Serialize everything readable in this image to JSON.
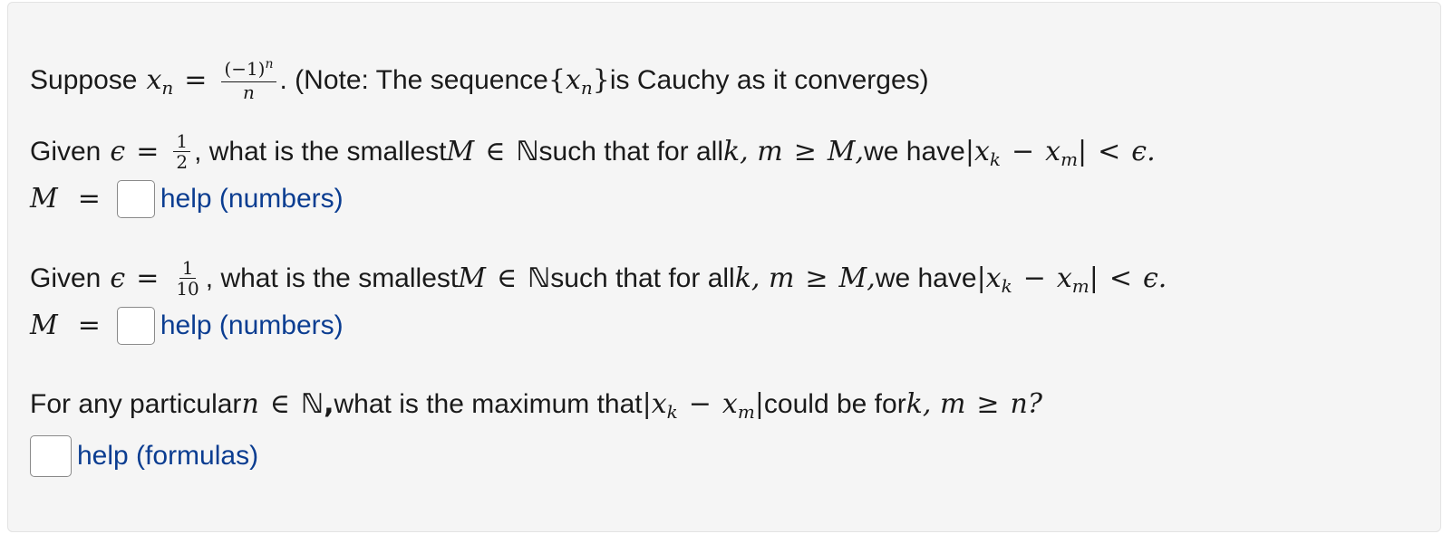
{
  "problem": {
    "intro": {
      "prefix": "Suppose",
      "var": "x",
      "var_sub": "n",
      "eq": "=",
      "frac_num": "(−1)",
      "frac_num_sup": "n",
      "frac_den": "n",
      "suffix_a": ". (Note: The sequence ",
      "seq_open": "{",
      "seq_var": "x",
      "seq_sub": "n",
      "seq_close": "}",
      "suffix_b": " is Cauchy as it converges)"
    },
    "parts": [
      {
        "given": "Given",
        "eps": "ϵ",
        "eq": "=",
        "frac_num": "1",
        "frac_den": "2",
        "text1": ", what is the smallest ",
        "M": "M",
        "in": "∈",
        "N": "ℕ",
        "text2": " such that for all ",
        "km": "k, m",
        "geq": "≥",
        "M2": "M,",
        "text3": " we have ",
        "abs": "|x",
        "sub_k": "k",
        "minus": "−",
        "xm": "x",
        "sub_m": "m",
        "abs_close": "|",
        "lt": "<",
        "eps_end": "ϵ.",
        "answer_label": "M",
        "answer_eq": "=",
        "answer_value": "",
        "help": "help (numbers)"
      },
      {
        "given": "Given",
        "eps": "ϵ",
        "eq": "=",
        "frac_num": "1",
        "frac_den": "10",
        "text1": ", what is the smallest ",
        "M": "M",
        "in": "∈",
        "N": "ℕ",
        "text2": " such that for all ",
        "km": "k, m",
        "geq": "≥",
        "M2": "M,",
        "text3": " we have ",
        "abs": "|x",
        "sub_k": "k",
        "minus": "−",
        "xm": "x",
        "sub_m": "m",
        "abs_close": "|",
        "lt": "<",
        "eps_end": "ϵ.",
        "answer_label": "M",
        "answer_eq": "=",
        "answer_value": "",
        "help": "help (numbers)"
      }
    ],
    "last": {
      "text1": "For any particular ",
      "n": "n",
      "in": "∈",
      "N": "ℕ,",
      "text2": " what is the maximum that ",
      "abs": "|x",
      "sub_k": "k",
      "minus": "−",
      "xm": "x",
      "sub_m": "m",
      "abs_close": "|",
      "text3": " could be for ",
      "km": "k, m",
      "geq": "≥",
      "n_end": "n?",
      "answer_value": "",
      "help": "help (formulas)"
    }
  }
}
